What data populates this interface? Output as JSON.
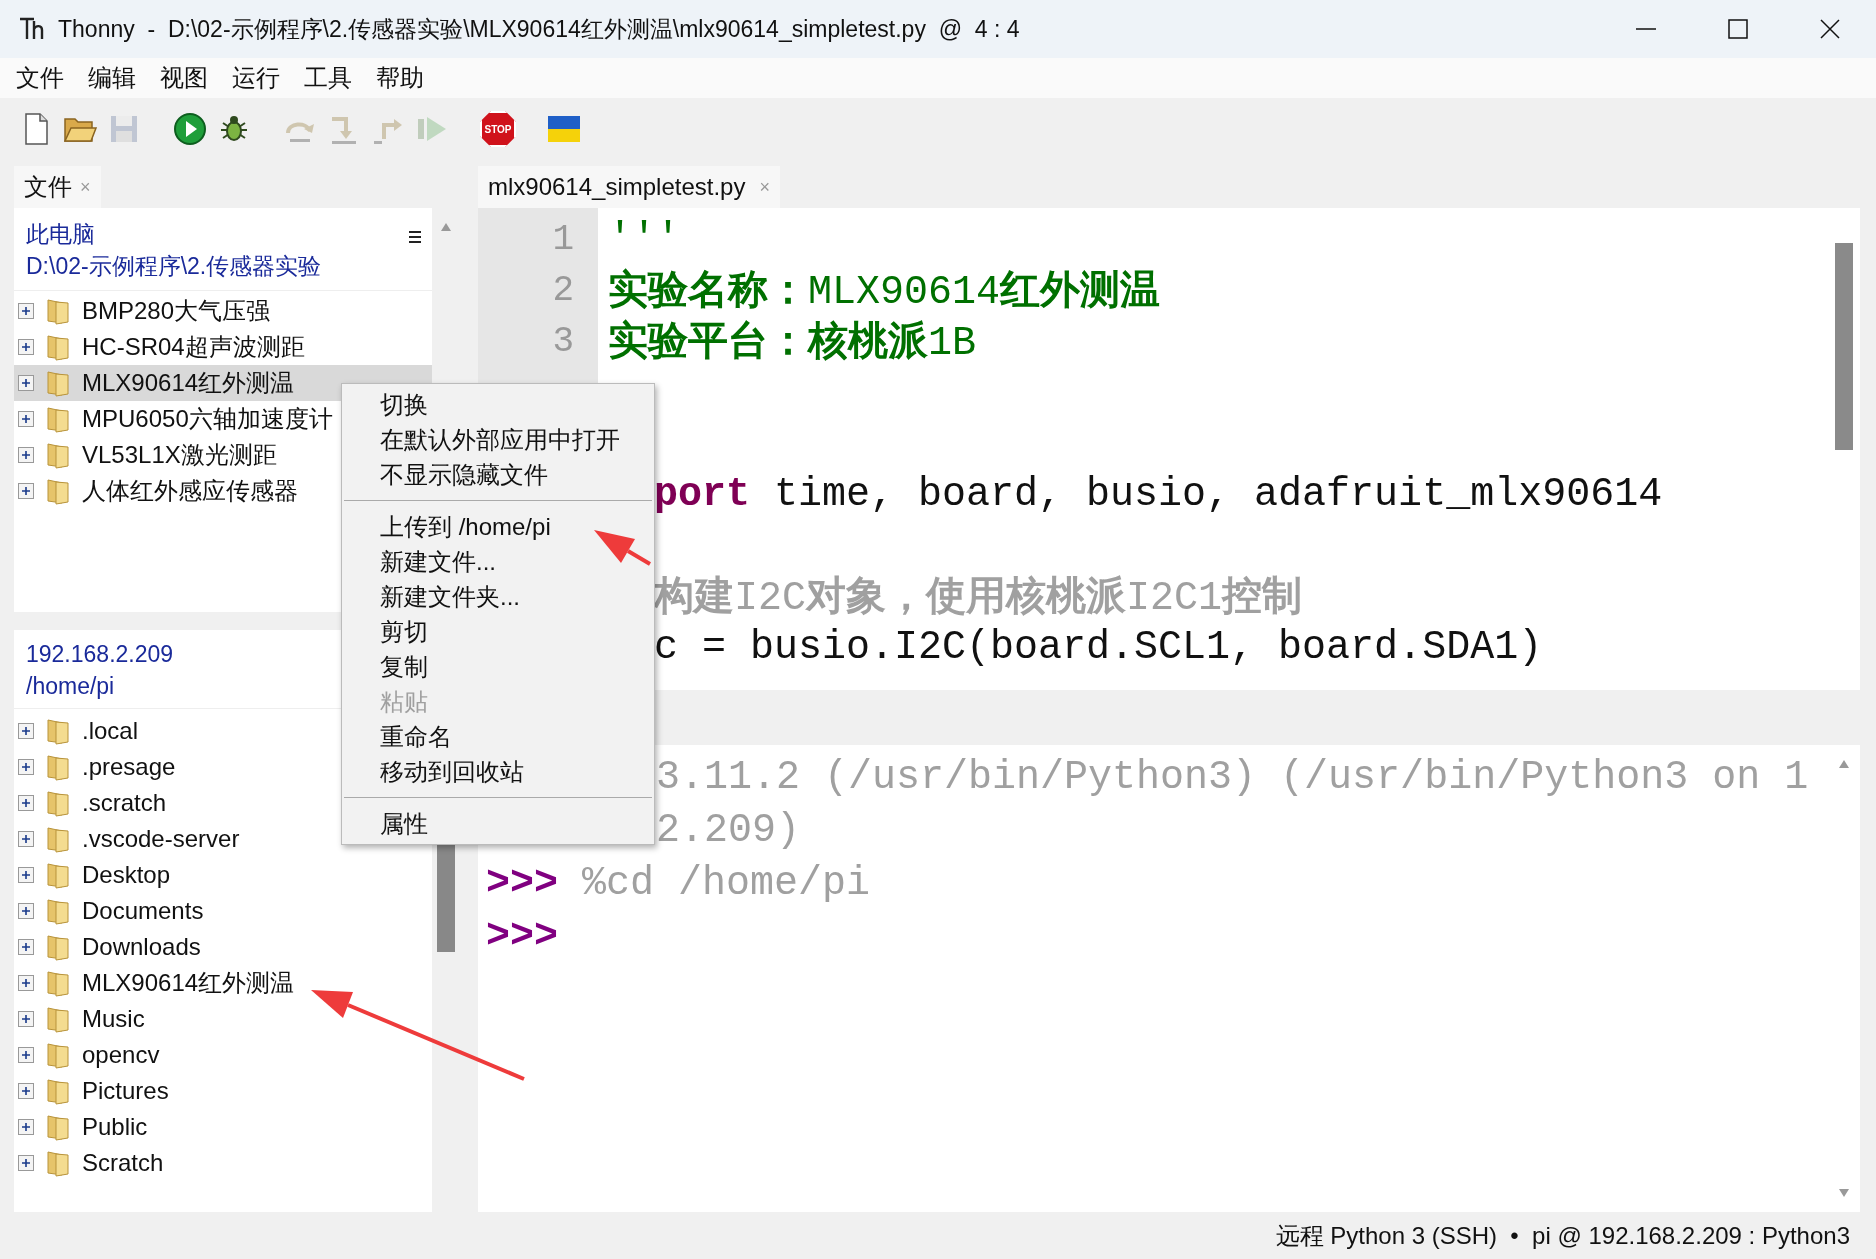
{
  "window": {
    "title": "Thonny  -  D:\\02-示例程序\\2.传感器实验\\MLX90614红外测温\\mlx90614_simpletest.py  @  4 : 4"
  },
  "menu": [
    "文件",
    "编辑",
    "视图",
    "运行",
    "工具",
    "帮助"
  ],
  "toolbar": [
    [
      {
        "kind": "new",
        "disabled": false
      },
      {
        "kind": "open",
        "disabled": false
      },
      {
        "kind": "save",
        "disabled": true
      }
    ],
    [
      {
        "kind": "run",
        "disabled": false
      },
      {
        "kind": "debug",
        "disabled": false
      }
    ],
    [
      {
        "kind": "step-over",
        "disabled": true
      },
      {
        "kind": "step-into",
        "disabled": true
      },
      {
        "kind": "step-out",
        "disabled": true
      },
      {
        "kind": "resume",
        "disabled": true
      }
    ],
    [
      {
        "kind": "stop",
        "label": "STOP",
        "disabled": false
      }
    ],
    [
      {
        "kind": "flag",
        "disabled": false
      }
    ]
  ],
  "files_panel": {
    "tab": {
      "label": "文件",
      "close": "×",
      "selected": true
    },
    "local": {
      "title": "此电脑",
      "path": "D:\\02-示例程序\\2.传感器实验",
      "items": [
        {
          "name": "BMP280大气压强",
          "selected": false
        },
        {
          "name": "HC-SR04超声波测距",
          "selected": false
        },
        {
          "name": "MLX90614红外测温",
          "selected": true
        },
        {
          "name": "MPU6050六轴加速度计",
          "selected": false
        },
        {
          "name": "VL53L1X激光测距",
          "selected": false
        },
        {
          "name": "人体红外感应传感器",
          "selected": false
        }
      ]
    },
    "remote": {
      "title": "192.168.2.209",
      "path": "/home/pi",
      "items": [
        {
          "name": ".local",
          "selected": false
        },
        {
          "name": ".presage",
          "selected": false
        },
        {
          "name": ".scratch",
          "selected": false
        },
        {
          "name": ".vscode-server",
          "selected": false
        },
        {
          "name": "Desktop",
          "selected": false
        },
        {
          "name": "Documents",
          "selected": false
        },
        {
          "name": "Downloads",
          "selected": false
        },
        {
          "name": "MLX90614红外测温",
          "selected": false
        },
        {
          "name": "Music",
          "selected": false
        },
        {
          "name": "opencv",
          "selected": false
        },
        {
          "name": "Pictures",
          "selected": false
        },
        {
          "name": "Public",
          "selected": false
        },
        {
          "name": "Scratch",
          "selected": false
        }
      ]
    }
  },
  "editor": {
    "tab": {
      "label": "mlx90614_simpletest.py",
      "close": "×",
      "selected": true
    },
    "lines": [
      {
        "kind": "code",
        "number": "1",
        "segments": [
          {
            "kind": "string",
            "text": "'''"
          }
        ]
      },
      {
        "kind": "code",
        "number": "2",
        "segments": [
          {
            "kind": "string-bold",
            "text": "实验名称："
          },
          {
            "kind": "string",
            "text": "MLX90614"
          },
          {
            "kind": "string-bold",
            "text": "红外测温"
          }
        ]
      },
      {
        "kind": "code",
        "number": "3",
        "segments": [
          {
            "kind": "string-bold",
            "text": "实验平台：核桃派"
          },
          {
            "kind": "string",
            "text": "1B"
          }
        ]
      },
      {
        "kind": "hidden"
      },
      {
        "kind": "blank"
      },
      {
        "kind": "code",
        "clipped": true,
        "segments": [
          {
            "kind": "keyword",
            "text": "port"
          },
          {
            "kind": "plain",
            "text": " time, board, busio, adafruit_mlx90614"
          }
        ]
      },
      {
        "kind": "blank"
      },
      {
        "kind": "code",
        "clipped": true,
        "segments": [
          {
            "kind": "comment-bold",
            "text": "构建"
          },
          {
            "kind": "comment",
            "text": "I2C"
          },
          {
            "kind": "comment-bold",
            "text": "对象，使用核桃派"
          },
          {
            "kind": "comment",
            "text": "I2C1"
          },
          {
            "kind": "comment-bold",
            "text": "控制"
          }
        ]
      },
      {
        "kind": "code",
        "clipped": true,
        "segments": [
          {
            "kind": "plain",
            "text": "c = busio.I2C(board.SCL1, board.SDA1)"
          }
        ]
      }
    ]
  },
  "shell": {
    "lines": [
      {
        "kind": "output",
        "clipped": true,
        "text": "3.11.2 (/usr/bin/Python3) (/usr/bin/Python3 on 1"
      },
      {
        "kind": "output",
        "clipped": true,
        "text": "2.209)"
      },
      {
        "kind": "input",
        "prompt": ">>>",
        "text": "%cd /home/pi"
      },
      {
        "kind": "input",
        "prompt": ">>>"
      }
    ]
  },
  "context_menu": {
    "items": [
      {
        "kind": "item",
        "label": "切换",
        "disabled": false
      },
      {
        "kind": "item",
        "label": "在默认外部应用中打开",
        "disabled": false
      },
      {
        "kind": "item",
        "label": "不显示隐藏文件",
        "disabled": false
      },
      {
        "kind": "separator"
      },
      {
        "kind": "item",
        "label": "上传到 /home/pi",
        "disabled": false
      },
      {
        "kind": "item",
        "label": "新建文件...",
        "disabled": false
      },
      {
        "kind": "item",
        "label": "新建文件夹...",
        "disabled": false
      },
      {
        "kind": "item",
        "label": "剪切",
        "disabled": false
      },
      {
        "kind": "item",
        "label": "复制",
        "disabled": false
      },
      {
        "kind": "item",
        "label": "粘贴",
        "disabled": true
      },
      {
        "kind": "item",
        "label": "重命名",
        "disabled": false
      },
      {
        "kind": "item",
        "label": "移动到回收站",
        "disabled": false
      },
      {
        "kind": "separator"
      },
      {
        "kind": "item",
        "label": "属性",
        "disabled": false
      }
    ]
  },
  "status_bar": {
    "text": "远程 Python 3 (SSH)  •  pi @ 192.168.2.209 : Python3"
  }
}
